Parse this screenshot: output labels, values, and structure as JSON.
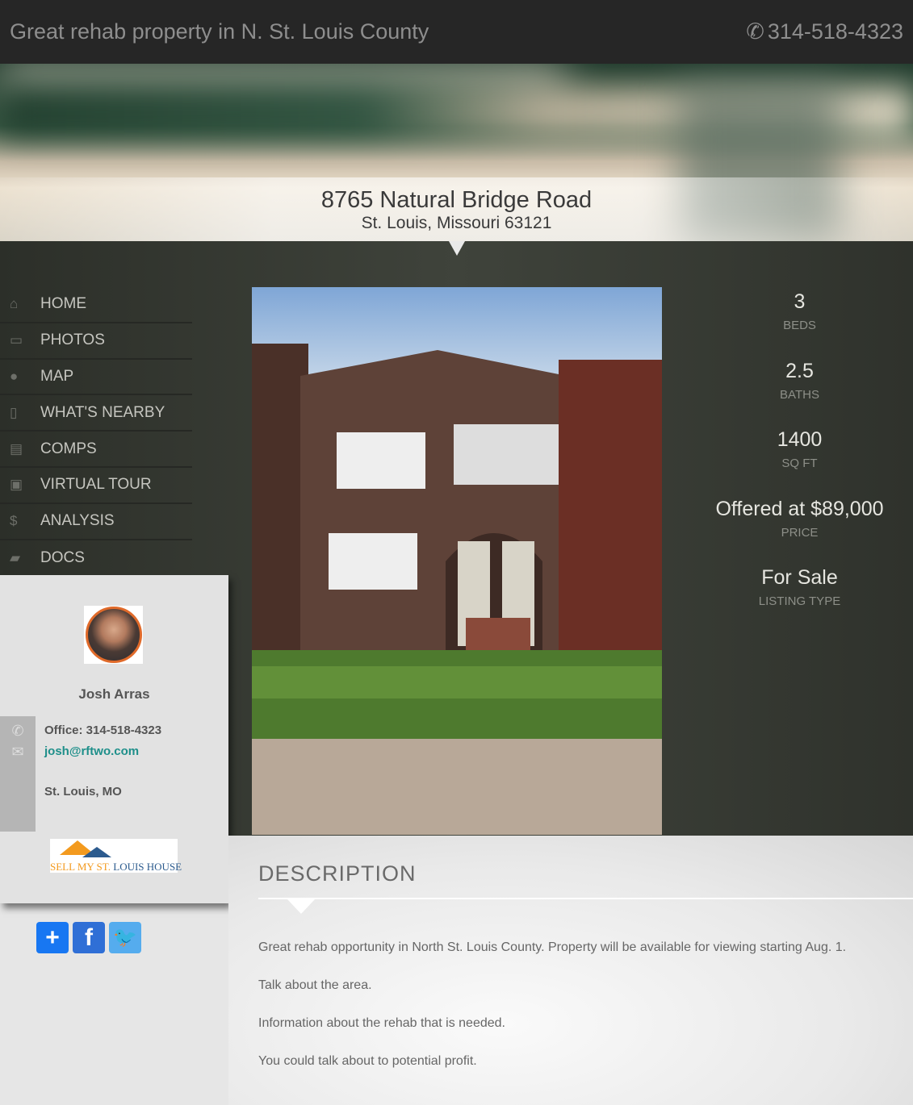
{
  "header": {
    "title": "Great rehab property in N. St. Louis County",
    "phone": "314-518-4323"
  },
  "address": {
    "street": "8765 Natural Bridge Road",
    "city": "St. Louis, Missouri 63121"
  },
  "nav": [
    {
      "label": "HOME",
      "icon": "home-icon",
      "glyph": "⌂"
    },
    {
      "label": "PHOTOS",
      "icon": "image-icon",
      "glyph": "▭"
    },
    {
      "label": "MAP",
      "icon": "map-marker-icon",
      "glyph": "●"
    },
    {
      "label": "WHAT'S NEARBY",
      "icon": "building-icon",
      "glyph": "▯"
    },
    {
      "label": "COMPS",
      "icon": "document-icon",
      "glyph": "▤"
    },
    {
      "label": "VIRTUAL TOUR",
      "icon": "video-icon",
      "glyph": "▣"
    },
    {
      "label": "ANALYSIS",
      "icon": "dollar-icon",
      "glyph": "$"
    },
    {
      "label": "DOCS",
      "icon": "folder-open-icon",
      "glyph": "▰"
    }
  ],
  "agent": {
    "name": "Josh Arras",
    "office": "Office: 314-518-4323",
    "email": "josh@rftwo.com",
    "location": "St. Louis, MO",
    "logo_text": "SELL MY ST. LOUIS HOUSE"
  },
  "social": [
    "share-plus",
    "facebook",
    "twitter"
  ],
  "stats": [
    {
      "value": "3",
      "label": "BEDS"
    },
    {
      "value": "2.5",
      "label": "BATHS"
    },
    {
      "value": "1400",
      "label": "SQ FT"
    },
    {
      "value": "Offered at $89,000",
      "label": "PRICE"
    },
    {
      "value": "For Sale",
      "label": "LISTING TYPE"
    }
  ],
  "description": {
    "heading": "DESCRIPTION",
    "paragraphs": [
      "Great rehab opportunity in North St. Louis County. Property will be available for viewing starting Aug. 1.",
      "Talk about the area.",
      "Information about the rehab that is needed.",
      "You could talk about to potential profit."
    ]
  },
  "colors": {
    "accent": "#1e8f8a",
    "topbar": "#262626",
    "facebook": "#3b5998",
    "twitter": "#55acee",
    "share": "#1877f2"
  }
}
